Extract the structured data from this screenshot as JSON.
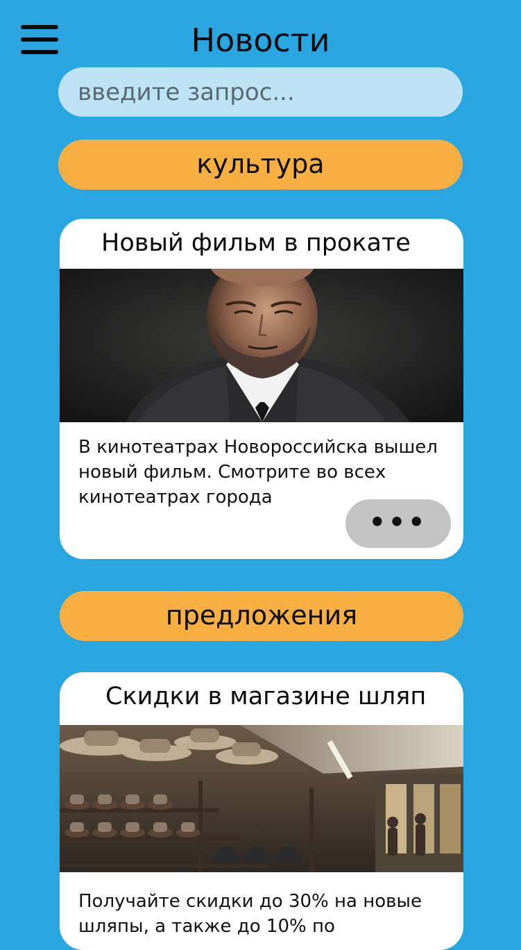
{
  "header": {
    "title": "Новости",
    "menu_icon": "hamburger-menu-icon"
  },
  "search": {
    "placeholder": "введите запрос..."
  },
  "sections": [
    {
      "category": "культура",
      "card": {
        "title": "Новый фильм в прокате",
        "image": "portrait of a bearded man in a suit",
        "text": "В кинотеатрах Новороссийска вышел новый фильм. Смотрите во всех кинотеатрах города",
        "more_label": "•••"
      }
    },
    {
      "category": "предложения",
      "card": {
        "title": "Скидки в магазине шляп",
        "image": "hat shop interior with shelves of hats",
        "text": "Получайте скидки до 30% на новые шляпы, а также до 10% по"
      }
    }
  ],
  "colors": {
    "background": "#29a6e0",
    "search_bg": "#bde3f5",
    "category_bg": "#f7af41",
    "card_bg": "#ffffff",
    "more_button_bg": "#c3c3c3"
  }
}
